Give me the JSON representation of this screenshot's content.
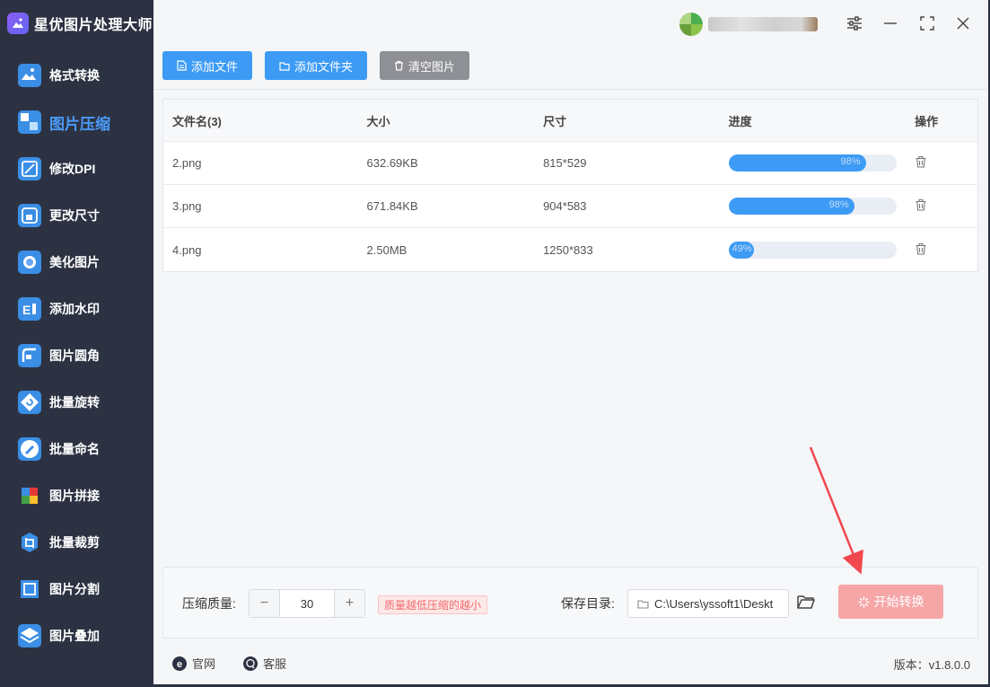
{
  "app": {
    "title": "星优图片处理大师"
  },
  "sidebar": {
    "items": [
      {
        "label": "格式转换",
        "icon": "image-convert-icon",
        "color": "#3a8ee6"
      },
      {
        "label": "图片压缩",
        "icon": "image-compress-icon",
        "color": "#3a8ee6",
        "active": true
      },
      {
        "label": "修改DPI",
        "icon": "dpi-icon",
        "color": "#3a8ee6"
      },
      {
        "label": "更改尺寸",
        "icon": "resize-icon",
        "color": "#3a8ee6"
      },
      {
        "label": "美化图片",
        "icon": "beautify-icon",
        "color": "#3a8ee6"
      },
      {
        "label": "添加水印",
        "icon": "watermark-icon",
        "color": "#3a8ee6"
      },
      {
        "label": "图片圆角",
        "icon": "round-corner-icon",
        "color": "#3a8ee6"
      },
      {
        "label": "批量旋转",
        "icon": "rotate-icon",
        "color": "#3a8ee6"
      },
      {
        "label": "批量命名",
        "icon": "rename-icon",
        "color": "#3a8ee6"
      },
      {
        "label": "图片拼接",
        "icon": "puzzle-icon",
        "color": "#3a8ee6"
      },
      {
        "label": "批量裁剪",
        "icon": "crop-icon",
        "color": "#3a8ee6"
      },
      {
        "label": "图片分割",
        "icon": "split-icon",
        "color": "#3a8ee6"
      },
      {
        "label": "图片叠加",
        "icon": "layers-icon",
        "color": "#3a8ee6"
      }
    ]
  },
  "toolbar": {
    "add_file": "添加文件",
    "add_folder": "添加文件夹",
    "clear": "清空图片"
  },
  "table": {
    "headers": {
      "name": "文件名(3)",
      "size": "大小",
      "dimensions": "尺寸",
      "progress": "进度",
      "actions": "操作"
    },
    "rows": [
      {
        "name": "2.png",
        "size": "632.69KB",
        "dimensions": "815*529",
        "progress": 0.82,
        "progress_label": "98%"
      },
      {
        "name": "3.png",
        "size": "671.84KB",
        "dimensions": "904*583",
        "progress": 0.75,
        "progress_label": "98%"
      },
      {
        "name": "4.png",
        "size": "2.50MB",
        "dimensions": "1250*833",
        "progress": 0.15,
        "progress_label": "49%"
      }
    ]
  },
  "settings": {
    "quality_label": "压缩质量:",
    "quality_value": "30",
    "quality_hint": "质量越低压缩的越小",
    "save_label": "保存目录:",
    "save_path": "C:\\Users\\yssoft1\\Deskt",
    "start_button": "开始转换"
  },
  "footer": {
    "website": "官网",
    "support": "客服",
    "version": "版本：v1.8.0.0"
  },
  "colors": {
    "accent": "#3d9bf5",
    "start_button": "#f6a6a6",
    "sidebar_bg": "#2d3243",
    "annotation_arrow": "#f0484e"
  }
}
